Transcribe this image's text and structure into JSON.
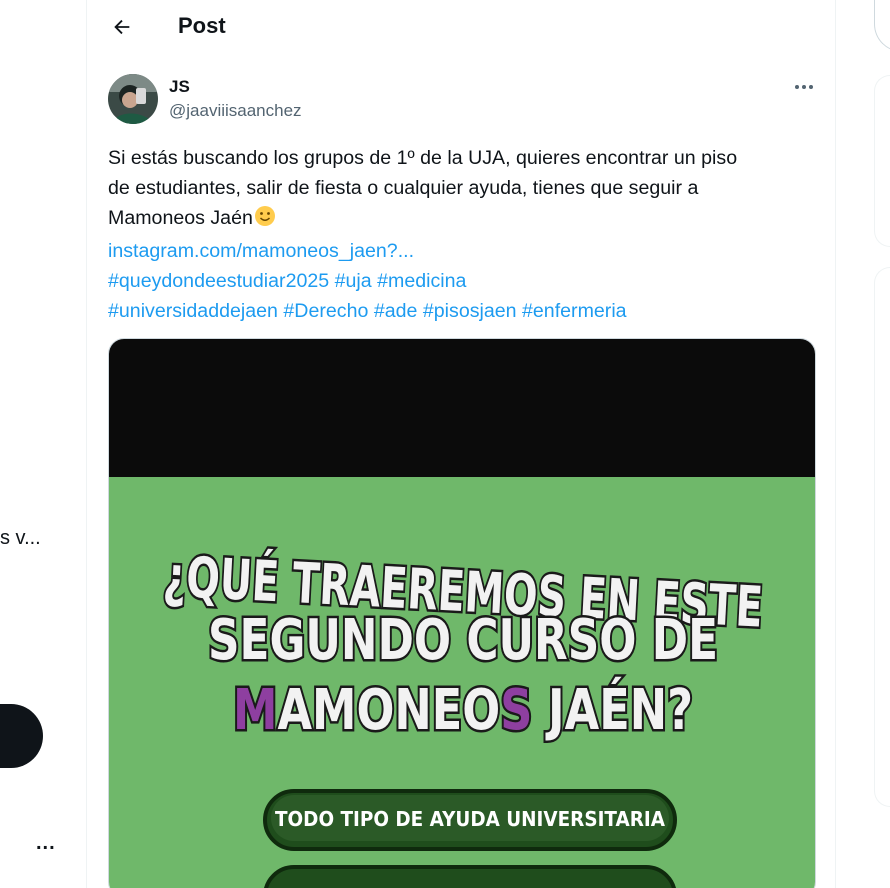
{
  "nav": {
    "truncated_label": "s v...",
    "more_label": "..."
  },
  "header": {
    "title": "Post"
  },
  "post": {
    "author_name": "JS",
    "author_handle": "@jaaviiisaanchez",
    "text_lines": [
      "Si estás buscando los grupos de 1º de la UJA, quieres encontrar un piso",
      "de estudiantes, salir de fiesta o cualquier ayuda, tienes que seguir a",
      "Mamoneos Jaén"
    ],
    "link": "instagram.com/mamoneos_jaen?...",
    "hashtags_line1": [
      "#queydondeestudiar2025",
      "#uja",
      "#medicina"
    ],
    "hashtags_line2": [
      "#universidaddejaen",
      "#Derecho",
      "#ade",
      "#pisosjaen",
      "#enfermeria"
    ]
  },
  "media": {
    "headline_line1": "¿QUÉ TRAEREMOS EN ESTE",
    "headline_line2": "SEGUNDO CURSO DE",
    "headline_line3_a": "M",
    "headline_line3_b": "AMONEO",
    "headline_line3_c": "S",
    "headline_line3_d": " JAÉN?",
    "button1": "TODO TIPO DE AYUDA UNIVERSITARIA",
    "colors": {
      "green_bg": "#6fb86a",
      "purple": "#8e3fa0",
      "dark_green": "#1f4d1c"
    }
  },
  "colors": {
    "link": "#1d9bf0",
    "text": "#0f1419",
    "secondary": "#536471"
  },
  "icons": {
    "back": "arrow-left-icon",
    "more": "more-horizontal-icon",
    "emoji": "slightly-smiling-face-emoji"
  }
}
